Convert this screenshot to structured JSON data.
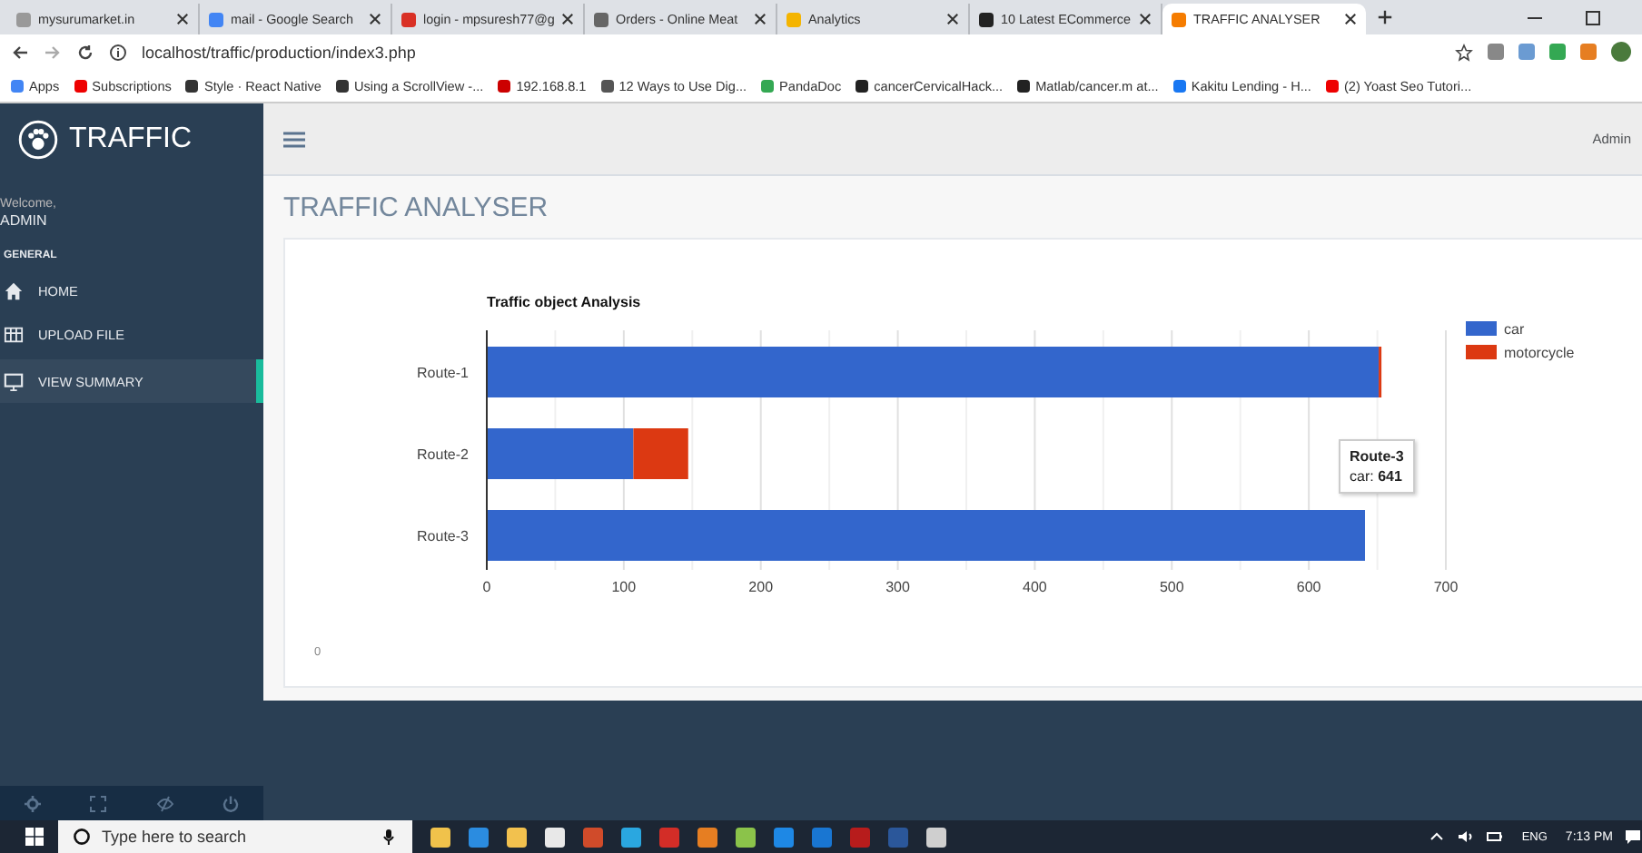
{
  "browser": {
    "tabs": [
      {
        "title": "mysurumarket.in",
        "selected": false
      },
      {
        "title": "mail - Google Search",
        "selected": false
      },
      {
        "title": "login - mpsuresh77@g",
        "selected": false
      },
      {
        "title": "Orders - Online Meat",
        "selected": false
      },
      {
        "title": "Analytics",
        "selected": false
      },
      {
        "title": "10 Latest ECommerce",
        "selected": false
      },
      {
        "title": "TRAFFIC ANALYSER",
        "selected": true
      }
    ],
    "address": "localhost/traffic/production/index3.php",
    "bookmarks": [
      "Apps",
      "Subscriptions",
      "Style · React Native",
      "Using a ScrollView -...",
      "192.168.8.1",
      "12 Ways to Use Dig...",
      "PandaDoc",
      "cancerCervicalHack...",
      "Matlab/cancer.m at...",
      "Kakitu Lending - H...",
      "(2) Yoast Seo Tutori..."
    ]
  },
  "sidebar": {
    "logo": "TRAFFIC",
    "welcome": "Welcome,",
    "user": "ADMIN",
    "section": "GENERAL",
    "items": [
      {
        "label": "HOME",
        "selected": false
      },
      {
        "label": "UPLOAD FILE",
        "selected": false
      },
      {
        "label": "VIEW SUMMARY",
        "selected": true
      }
    ]
  },
  "header": {
    "user": "Admin"
  },
  "page": {
    "title": "TRAFFIC ANALYSER",
    "footer_value": "0",
    "chart_data": {
      "type": "bar",
      "orientation": "horizontal",
      "stacked": true,
      "title": "Traffic object Analysis",
      "categories": [
        "Route-1",
        "Route-2",
        "Route-3"
      ],
      "series": [
        {
          "name": "car",
          "color": "#3366cc",
          "values": [
            651,
            107,
            641
          ]
        },
        {
          "name": "motorcycle",
          "color": "#dc3912",
          "values": [
            2,
            40,
            0
          ]
        }
      ],
      "xlim": [
        0,
        700
      ],
      "grid": true,
      "legend": true,
      "xticks": [
        0,
        100,
        200,
        300,
        400,
        500,
        600,
        700
      ]
    },
    "tooltip": {
      "title": "Route-3",
      "text": "car: **641**"
    }
  },
  "taskbar": {
    "search_placeholder": "Type here to search",
    "language": "ENG",
    "time": "7:13 PM"
  }
}
